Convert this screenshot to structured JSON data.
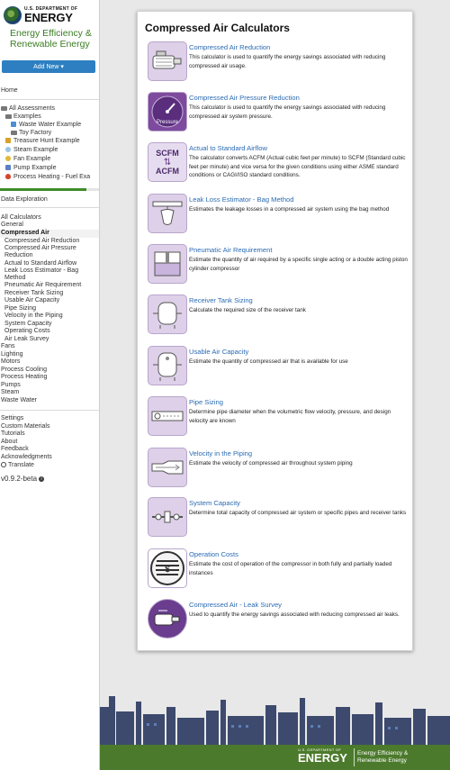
{
  "logo": {
    "sub": "U.S. DEPARTMENT OF",
    "main": "ENERGY",
    "office_line1": "Energy Efficiency &",
    "office_line2": "Renewable Energy"
  },
  "add_new_label": "Add New ▾",
  "sidebar": {
    "home": "Home",
    "all_assessments": "All Assessments",
    "examples": "Examples",
    "example_items": [
      "Waste Water Example",
      "Toy Factory",
      "Treasure Hunt Example",
      "Steam Example",
      "Fan Example",
      "Pump Example",
      "Process Heating - Fuel Exa"
    ],
    "data_exploration": "Data Exploration",
    "all_calculators": "All Calculators",
    "general": "General",
    "compressed_air": "Compressed Air",
    "ca_items": [
      "Compressed Air Reduction",
      "Compressed Air Pressure",
      "Reduction",
      "Actual to Standard Airflow",
      "Leak Loss Estimator - Bag",
      "Method",
      "Pneumatic Air Requirement",
      "Receiver Tank Sizing",
      "Usable Air Capacity",
      "Pipe Sizing",
      "Velocity in the Piping",
      "System Capacity",
      "Operating Costs",
      "Air Leak Survey"
    ],
    "categories": [
      "Fans",
      "Lighting",
      "Motors",
      "Process Cooling",
      "Process Heating",
      "Pumps",
      "Steam",
      "Waste Water"
    ],
    "bottom": [
      "Settings",
      "Custom Materials",
      "Tutorials",
      "About",
      "Feedback",
      "Acknowledgments",
      "Translate"
    ],
    "version": "v0.9.2-beta"
  },
  "main": {
    "title": "Compressed Air Calculators",
    "calculators": [
      {
        "title": "Compressed Air Reduction",
        "desc": "This calculator is used to quantify the energy savings associated with reducing compressed air usage.",
        "icon": "compressor-icon"
      },
      {
        "title": "Compressed Air Pressure Reduction",
        "desc": "This calculator is used to quantify the energy savings associated with reducing compressed air system pressure.",
        "icon": "pressure-gauge-icon",
        "icon_label": "Pressure"
      },
      {
        "title": "Actual to Standard Airflow",
        "desc": "The calculator converts ACFM (Actual cubic feet per minute) to SCFM (Standard cubic feet per minute) and vice versa for the given conditions using either ASME standard conditions or CAGI/ISO standard conditions.",
        "icon": "scfm-acfm-icon",
        "icon_top": "SCFM",
        "icon_bottom": "ACFM"
      },
      {
        "title": "Leak Loss Estimator - Bag Method",
        "desc": "Estimates the leakage losses in a compressed air system using the bag method",
        "icon": "leak-bag-icon"
      },
      {
        "title": "Pneumatic Air Requirement",
        "desc": "Estimate the quantity of air required by a specific single acting or a double acting piston cylinder compressor",
        "icon": "piston-cylinder-icon"
      },
      {
        "title": "Receiver Tank Sizing",
        "desc": "Calculate the required size of the receiver tank",
        "icon": "receiver-tank-icon"
      },
      {
        "title": "Usable Air Capacity",
        "desc": "Estimate the quantity of compressed air that is available for use",
        "icon": "air-capacity-tank-icon"
      },
      {
        "title": "Pipe Sizing",
        "desc": "Determine pipe diameter when the volumetric flow velocity, pressure, and design velocity are known",
        "icon": "pipe-icon"
      },
      {
        "title": "Velocity in the Piping",
        "desc": "Estimate the velocity of compressed air throughout system piping",
        "icon": "pipe-velocity-icon"
      },
      {
        "title": "System Capacity",
        "desc": "Determine total capacity of compressed air system or specific pipes and receiver tanks",
        "icon": "system-capacity-icon"
      },
      {
        "title": "Operation Costs",
        "desc": "Estimate the cost of operation of the compressor in both fully and partially loaded instances",
        "icon": "coins-icon"
      },
      {
        "title": "Compressed Air - Leak Survey",
        "desc": "Used to quantify the energy savings associated with reducing compressed air leaks.",
        "icon": "leak-survey-icon"
      }
    ]
  },
  "footer": {
    "sub": "U.S. DEPARTMENT OF",
    "main": "ENERGY",
    "office_line1": "Energy Efficiency &",
    "office_line2": "Renewable Energy"
  },
  "colors": {
    "accent": "#2d7fc1",
    "link": "#2a6bb3",
    "brand_green": "#4c7a2c",
    "icon_bg": "#ddd0e8",
    "skyline": "#3d4a6e"
  }
}
